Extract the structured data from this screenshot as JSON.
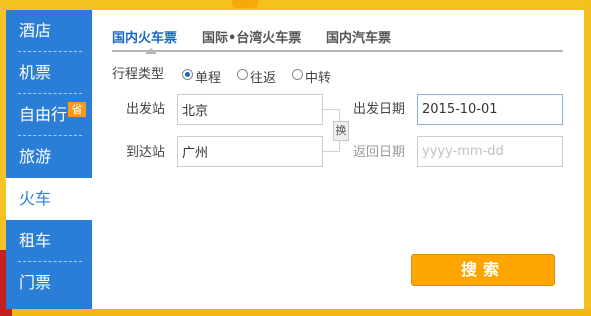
{
  "sidebar": {
    "items": [
      {
        "label": "酒店"
      },
      {
        "label": "机票"
      },
      {
        "label": "自由行",
        "badge": "省"
      },
      {
        "label": "旅游"
      },
      {
        "label": "火车",
        "active": true
      },
      {
        "label": "租车"
      },
      {
        "label": "门票"
      }
    ]
  },
  "tabs": [
    {
      "label": "国内火车票",
      "active": true
    },
    {
      "label": "国际•台湾火车票"
    },
    {
      "label": "国内汽车票"
    }
  ],
  "trip_type": {
    "label": "行程类型",
    "options": [
      {
        "label": "单程",
        "checked": true
      },
      {
        "label": "往返",
        "checked": false
      },
      {
        "label": "中转",
        "checked": false
      }
    ]
  },
  "form": {
    "departure_station_label": "出发站",
    "departure_station_value": "北京",
    "arrival_station_label": "到达站",
    "arrival_station_value": "广州",
    "swap_label": "换",
    "departure_date_label": "出发日期",
    "departure_date_value": "2015-10-01",
    "return_date_label": "返回日期",
    "return_date_placeholder": "yyyy-mm-dd"
  },
  "search_button": {
    "label": "搜索"
  },
  "colors": {
    "sidebar_blue": "#2b7ed8",
    "tab_active": "#1b66c9",
    "search_orange": "#ffa500",
    "background_yellow": "#f6c226"
  }
}
